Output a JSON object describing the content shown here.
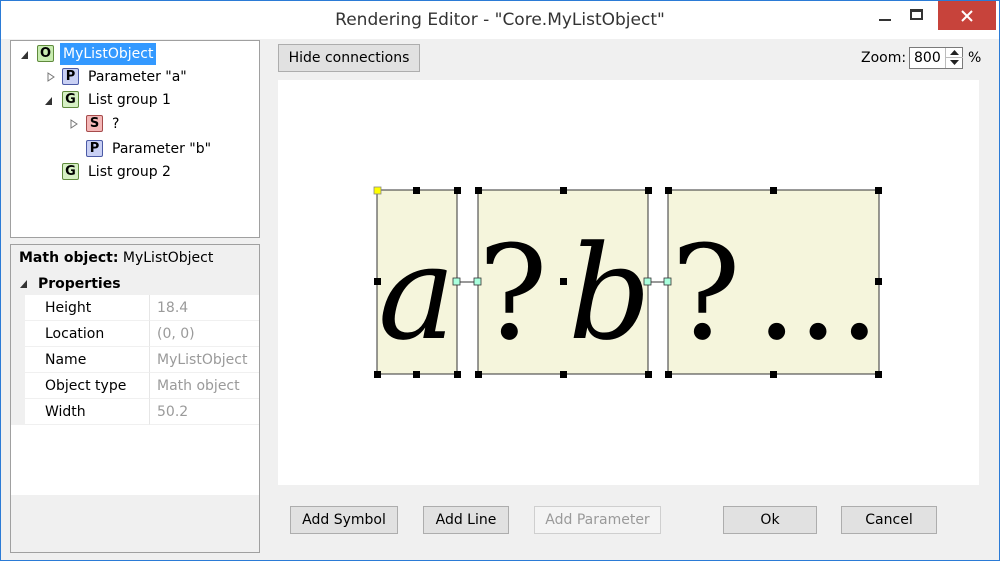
{
  "window": {
    "title": "Rendering Editor - \"Core.MyListObject\""
  },
  "tree": {
    "items": [
      {
        "icon": "O",
        "label": "MyListObject",
        "selected": true,
        "expanded": true
      },
      {
        "icon": "P",
        "label": "Parameter \"a\"",
        "expanded": false
      },
      {
        "icon": "G",
        "label": "List group 1",
        "expanded": true
      },
      {
        "icon": "S",
        "label": "?",
        "expanded": false
      },
      {
        "icon": "P",
        "label": "Parameter \"b\""
      },
      {
        "icon": "G",
        "label": "List group 2"
      }
    ]
  },
  "properties": {
    "header_key": "Math object:",
    "header_value": "MyListObject",
    "category": "Properties",
    "rows": [
      {
        "key": "Height",
        "value": "18.4"
      },
      {
        "key": "Location",
        "value": "(0, 0)"
      },
      {
        "key": "Name",
        "value": "MyListObject"
      },
      {
        "key": "Object type",
        "value": "Math object"
      },
      {
        "key": "Width",
        "value": "50.2"
      }
    ]
  },
  "toolbar": {
    "hide_connections": "Hide connections",
    "zoom_label": "Zoom:",
    "zoom_value": "800",
    "zoom_unit": "%"
  },
  "canvas": {
    "glyphs": [
      "a",
      "?",
      "b",
      "?",
      "..."
    ]
  },
  "buttons": {
    "add_symbol": "Add Symbol",
    "add_line": "Add Line",
    "add_parameter": "Add Parameter",
    "ok": "Ok",
    "cancel": "Cancel"
  },
  "colors": {
    "selection": "#3399ff",
    "box_fill": "#f5f5dc",
    "close_button": "#c7433b",
    "anchor_yellow": "#ffff00",
    "connector_teal": "#aaffdd"
  }
}
